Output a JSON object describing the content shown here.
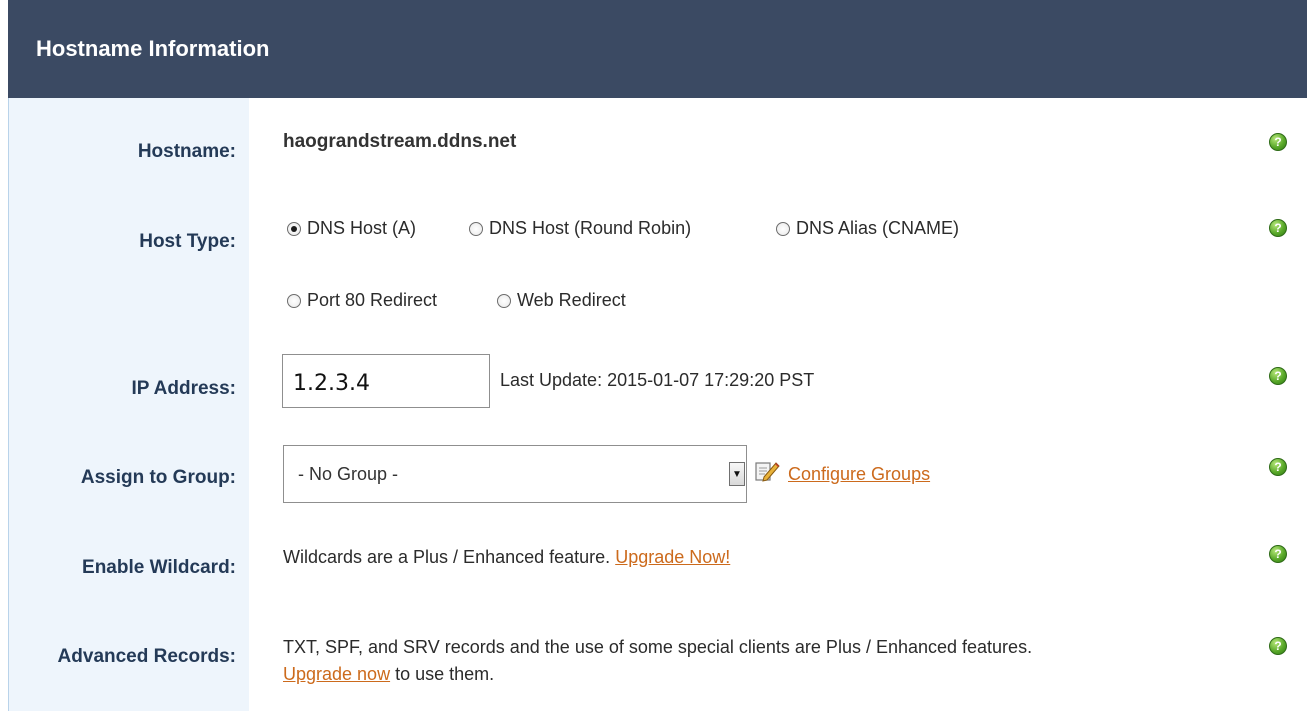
{
  "header": {
    "title": "Hostname Information"
  },
  "rows": {
    "hostname": {
      "label": "Hostname:",
      "value": "haograndstream.ddns.net"
    },
    "host_type": {
      "label": "Host Type:",
      "options": [
        {
          "label": "DNS Host (A)",
          "checked": true
        },
        {
          "label": "DNS Host (Round Robin)",
          "checked": false
        },
        {
          "label": "DNS Alias (CNAME)",
          "checked": false
        },
        {
          "label": "Port 80 Redirect",
          "checked": false
        },
        {
          "label": "Web Redirect",
          "checked": false
        }
      ]
    },
    "ip": {
      "label": "IP Address:",
      "value": "1.2.3.4",
      "last_update": "Last Update: 2015-01-07 17:29:20 PST"
    },
    "group": {
      "label": "Assign to Group:",
      "selected": "- No Group -",
      "configure_link": "Configure Groups"
    },
    "wildcard": {
      "label": "Enable Wildcard:",
      "text": "Wildcards are a Plus / Enhanced feature.",
      "link": "Upgrade Now!"
    },
    "advanced": {
      "label": "Advanced Records:",
      "text1": "TXT, SPF, and SRV records and the use of some special clients are Plus / Enhanced features.",
      "link": "Upgrade now",
      "text2": "to use them."
    }
  },
  "icons": {
    "help": "help-icon",
    "edit": "edit-icon"
  },
  "colors": {
    "header_bg": "#3b4a63",
    "label_bg": "#eef5fc",
    "link": "#cc6a1c",
    "help_green": "#5aa92a"
  }
}
